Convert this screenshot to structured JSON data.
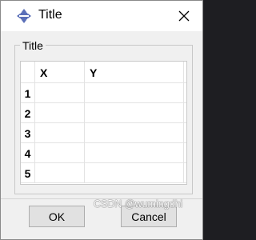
{
  "window": {
    "title": "Title",
    "icon": "axis-cross-icon",
    "close_glyph": "✕"
  },
  "group": {
    "label": "Title"
  },
  "table": {
    "columns": [
      "X",
      "Y"
    ],
    "rows": [
      {
        "num": "1",
        "x": "",
        "y": ""
      },
      {
        "num": "2",
        "x": "",
        "y": ""
      },
      {
        "num": "3",
        "x": "",
        "y": ""
      },
      {
        "num": "4",
        "x": "",
        "y": ""
      },
      {
        "num": "5",
        "x": "",
        "y": ""
      }
    ]
  },
  "buttons": {
    "ok": "OK",
    "cancel": "Cancel"
  },
  "watermark": "CSDN @wumingdhi",
  "colors": {
    "icon_blue": "#5a6fb8",
    "window_bg": "#f0f0f0"
  }
}
